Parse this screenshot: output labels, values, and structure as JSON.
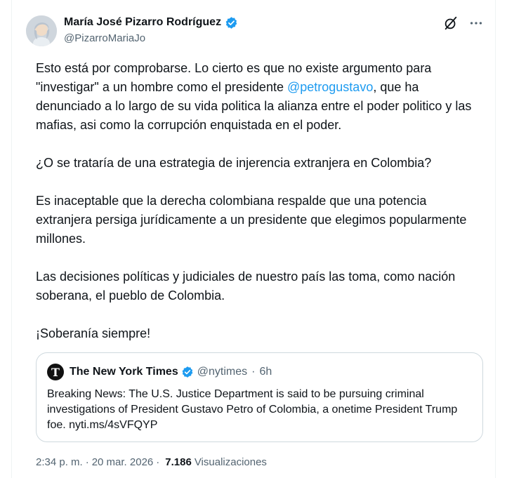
{
  "author": {
    "display_name": "María José Pizarro Rodríguez",
    "handle": "@PizarroMariaJo"
  },
  "icons": {
    "verified": "verified-badge-icon",
    "grok": "grok-icon",
    "more": "more-options-icon"
  },
  "tweet": {
    "paragraph_1_before_mention": "Esto está por comprobarse. Lo cierto es que no existe argumento para \"investigar\" a un hombre como el presidente ",
    "mention": "@petrogustavo",
    "paragraph_1_after_mention": ", que ha denunciado a lo largo de su vida politica la alianza entre el poder politico y las mafias, asi como la corrupción enquistada en el poder.",
    "paragraph_2": "¿O se trataría de una estrategia de injerencia extranjera en Colombia?",
    "paragraph_3": "Es inaceptable que la derecha colombiana respalde que una potencia extranjera persiga jurídicamente a un presidente que elegimos popularmente millones.",
    "paragraph_4": "Las decisiones políticas y judiciales de nuestro país las toma, como nación soberana, el pueblo de Colombia.",
    "paragraph_5": "¡Soberanía siempre!"
  },
  "quote": {
    "logo_glyph": "T",
    "display_name": "The New York Times",
    "handle": "@nytimes",
    "separator": "·",
    "time": "6h",
    "text": "Breaking News: The U.S. Justice Department is said to be pursuing criminal investigations of President Gustavo Petro of Colombia, a onetime President Trump foe. nyti.ms/4sVFQYP"
  },
  "meta": {
    "time": "2:34 p. m.",
    "separator": "·",
    "date": "20 mar. 2026",
    "views_count": "7.186",
    "views_label": "Visualizaciones"
  },
  "colors": {
    "accent": "#1d9bf0",
    "text": "#0f1419",
    "secondary": "#536471",
    "border": "#cfd9de"
  }
}
